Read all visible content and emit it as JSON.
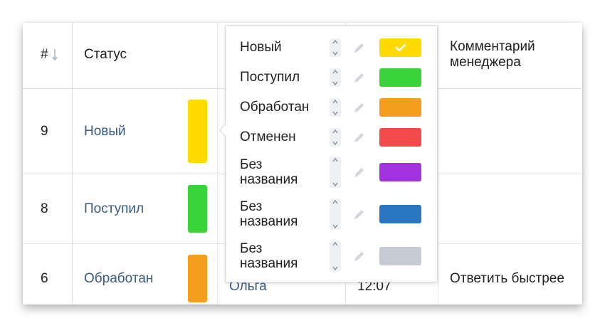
{
  "table": {
    "header": {
      "num_label": "#",
      "status_label": "Статус",
      "comment_label_line1": "Комментарий",
      "comment_label_line2": "менеджера"
    },
    "rows": [
      {
        "num": "9",
        "status": "Новый",
        "status_color": "#ffdb00",
        "manager": "",
        "time": "",
        "comment": ""
      },
      {
        "num": "8",
        "status": "Поступил",
        "status_color": "#3ad43a",
        "manager": "",
        "time": "",
        "comment": ""
      },
      {
        "num": "6",
        "status": "Обработан",
        "status_color": "#f79d1e",
        "manager": "Ольга",
        "time": "12:07",
        "comment": "Ответить быстрее"
      }
    ]
  },
  "status_popup": {
    "items": [
      {
        "label_line1": "Новый",
        "label_line2": "",
        "color": "#ffdb00",
        "selected": true
      },
      {
        "label_line1": "Поступил",
        "label_line2": "",
        "color": "#3ad43a",
        "selected": false
      },
      {
        "label_line1": "Обработан",
        "label_line2": "",
        "color": "#f79d1e",
        "selected": false
      },
      {
        "label_line1": "Отменен",
        "label_line2": "",
        "color": "#f2494b",
        "selected": false
      },
      {
        "label_line1": "Без",
        "label_line2": "названия",
        "color": "#a232dd",
        "selected": false
      },
      {
        "label_line1": "Без",
        "label_line2": "названия",
        "color": "#2a76c2",
        "selected": false
      },
      {
        "label_line1": "Без",
        "label_line2": "названия",
        "color": "#c5cad3",
        "selected": false
      }
    ]
  },
  "colors": {
    "link": "#3a5a80",
    "border": "#e2e5ea",
    "sort_arrow": "#a9b6cc"
  }
}
